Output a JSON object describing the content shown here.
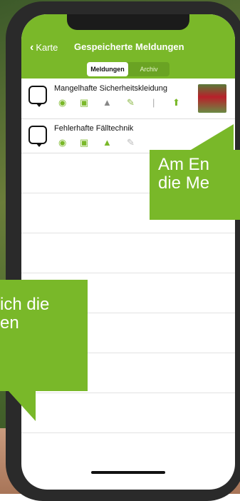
{
  "nav": {
    "back_label": "Karte",
    "title": "Gespeicherte Meldungen"
  },
  "segments": {
    "active": "Meldungen",
    "inactive": "Archiv"
  },
  "reports": [
    {
      "name": "Mangelhafte Sicherheitskleidung"
    },
    {
      "name": "Fehlerhafte Fälltechnik"
    }
  ],
  "callouts": {
    "right": "Am En\ndie Me",
    "left": "ich die\nen"
  },
  "colors": {
    "accent": "#7ab829"
  },
  "icons": [
    "chevron-left-icon",
    "medical-bag-icon",
    "chat-icon",
    "location-icon",
    "camera-icon",
    "forest-icon",
    "note-icon",
    "upload-icon"
  ]
}
